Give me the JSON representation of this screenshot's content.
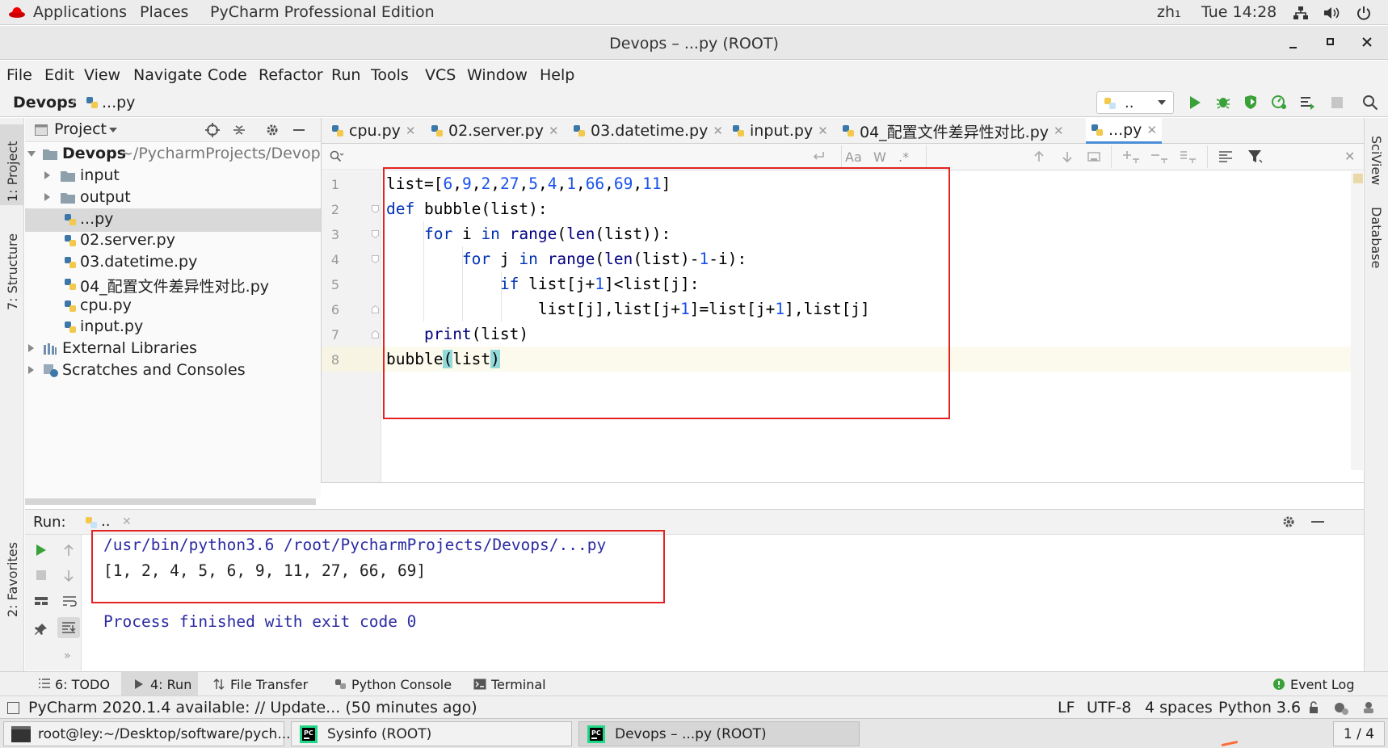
{
  "topbar": {
    "applications": "Applications",
    "places": "Places",
    "app_name": "PyCharm Professional Edition",
    "input_method": "zh₁",
    "clock": "Tue 14:28"
  },
  "window": {
    "title": "Devops – ...py (ROOT)"
  },
  "menu": {
    "file": "File",
    "edit": "Edit",
    "view": "View",
    "navigate": "Navigate",
    "code": "Code",
    "refactor": "Refactor",
    "run": "Run",
    "tools": "Tools",
    "vcs": "VCS",
    "window": "Window",
    "help": "Help"
  },
  "navbar": {
    "project": "Devops",
    "file": "...py",
    "run_config": ".."
  },
  "sidebar_left": {
    "project_tab": "1: Project",
    "structure_tab": "7: Structure",
    "favorites_tab": "2: Favorites"
  },
  "sidebar_right": {
    "sciview_tab": "SciView",
    "database_tab": "Database"
  },
  "project_panel": {
    "title": "Project",
    "root_name": "Devops",
    "root_path": "~/PycharmProjects/Devops",
    "items": [
      {
        "label": "input"
      },
      {
        "label": "output"
      },
      {
        "label": "...py"
      },
      {
        "label": "02.server.py"
      },
      {
        "label": "03.datetime.py"
      },
      {
        "label": "04_配置文件差异性对比.py"
      },
      {
        "label": "cpu.py"
      },
      {
        "label": "input.py"
      }
    ],
    "external_libraries": "External Libraries",
    "scratches": "Scratches and Consoles"
  },
  "tabs": [
    {
      "label": "cpu.py"
    },
    {
      "label": "02.server.py"
    },
    {
      "label": "03.datetime.py"
    },
    {
      "label": "input.py"
    },
    {
      "label": "04_配置文件差异性对比.py"
    },
    {
      "label": "...py"
    }
  ],
  "search": {
    "match_case": "Aa",
    "words": "W",
    "regex": ".*"
  },
  "editor": {
    "line_numbers": [
      "1",
      "2",
      "3",
      "4",
      "5",
      "6",
      "7",
      "8"
    ],
    "lines": [
      "list=[6,9,2,27,5,4,1,66,69,11]",
      "def bubble(list):",
      "    for i in range(len(list)):",
      "        for j in range(len(list)-1-i):",
      "            if list[j+1]<list[j]:",
      "                list[j],list[j+1]=list[j+1],list[j]",
      "    print(list)",
      "bubble(list)"
    ]
  },
  "run_panel": {
    "label": "Run:",
    "config_name": "..",
    "command": "/usr/bin/python3.6 /root/PycharmProjects/Devops/...py",
    "result": "[1, 2, 4, 5, 6, 9, 11, 27, 66, 69]",
    "exit": "Process finished with exit code 0"
  },
  "tool_tabs": {
    "todo": "6: TODO",
    "run": "4: Run",
    "file_transfer": "File Transfer",
    "python_console": "Python Console",
    "terminal": "Terminal",
    "event_log": "Event Log"
  },
  "status": {
    "message": "PyCharm 2020.1.4 available: // Update... (50 minutes ago)",
    "line_sep": "LF",
    "encoding": "UTF-8",
    "indent": "4 spaces",
    "interpreter": "Python 3.6"
  },
  "taskbar": {
    "terminal": "root@ley:~/Desktop/software/pych...",
    "sysinfo": "Sysinfo (ROOT)",
    "devops": "Devops – ...py (ROOT)",
    "workspace": "1 / 4"
  },
  "colors": {
    "keyword": "#0033b3",
    "number": "#1750eb",
    "highlight_box": "#e32222",
    "run_green": "#3aa13a"
  }
}
